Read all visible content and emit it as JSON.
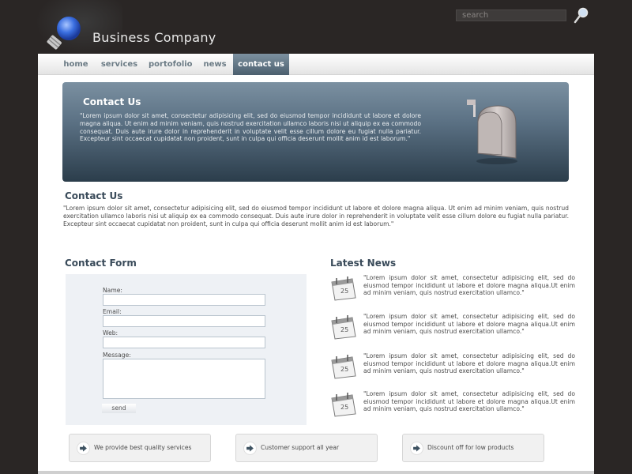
{
  "header": {
    "brand_name": "Business Company",
    "logo_icon": "lightbulb-icon",
    "search_placeholder": "search",
    "search_icon": "magnifier-icon"
  },
  "nav": {
    "items": [
      {
        "label": "home"
      },
      {
        "label": "services"
      },
      {
        "label": "portofolio"
      },
      {
        "label": "news"
      },
      {
        "label": "contact us"
      }
    ],
    "active_index": 4
  },
  "banner": {
    "title": "Contact Us",
    "text": "\"Lorem ipsum dolor sit amet, consectetur adipisicing elit, sed do eiusmod tempor incididunt ut labore et dolore magna aliqua. Ut enim ad minim veniam, quis nostrud exercitation ullamco laboris nisi ut aliquip ex ea commodo consequat. Duis aute irure dolor in reprehenderit in voluptate velit esse cillum dolore eu fugiat nulla pariatur. Excepteur sint occaecat cupidatat non proident, sunt in culpa qui officia deserunt mollit anim id est laborum.\"",
    "icon": "mailbox-icon"
  },
  "contact": {
    "title": "Contact Us",
    "text": "\"Lorem ipsum dolor sit amet, consectetur adipisicing elit, sed do eiusmod tempor incididunt ut labore et dolore magna aliqua. Ut enim ad minim veniam, quis nostrud exercitation ullamco laboris nisi ut aliquip ex ea commodo consequat. Duis aute irure dolor in reprehenderit in voluptate velit esse cillum dolore eu fugiat nulla pariatur. Excepteur sint occaecat cupidatat non proident, sunt in culpa qui officia deserunt mollit anim id est laborum.\""
  },
  "form": {
    "title": "Contact Form",
    "name_label": "Name:",
    "email_label": "Email:",
    "web_label": "Web:",
    "message_label": "Message:",
    "send_label": "send"
  },
  "news": {
    "title": "Latest News",
    "items": [
      {
        "text": "\"Lorem ipsum dolor sit amet, consectetur adipisicing elit, sed do eiusmod tempor incididunt ut labore et dolore magna aliqua.Ut enim ad minim veniam, quis nostrud exercitation ullamco.\"",
        "day": "25"
      },
      {
        "text": "\"Lorem ipsum dolor sit amet, consectetur adipisicing elit, sed do eiusmod tempor incididunt ut labore et dolore magna aliqua.Ut enim ad minim veniam, quis nostrud exercitation ullamco.\"",
        "day": "25"
      },
      {
        "text": "\"Lorem ipsum dolor sit amet, consectetur adipisicing elit, sed do eiusmod tempor incididunt ut labore et dolore magna aliqua.Ut enim ad minim veniam, quis nostrud exercitation ullamco.\"",
        "day": "25"
      },
      {
        "text": "\"Lorem ipsum dolor sit amet, consectetur adipisicing elit, sed do eiusmod tempor incididunt ut labore et dolore magna aliqua.Ut enim ad minim veniam, quis nostrud exercitation ullamco.\"",
        "day": "25"
      }
    ]
  },
  "services": [
    {
      "label": "We provide best quality services"
    },
    {
      "label": "Customer support all year"
    },
    {
      "label": "Discount off for low products"
    }
  ],
  "colors": {
    "background": "#2a2625",
    "accent": "#4b5f6e",
    "heading": "#3a4b5a"
  }
}
